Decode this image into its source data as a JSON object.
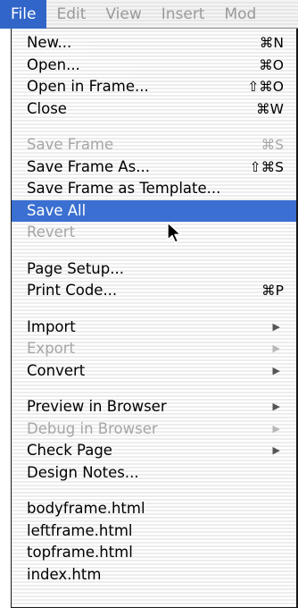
{
  "menubar": {
    "items": [
      {
        "label": "File",
        "active": true
      },
      {
        "label": "Edit"
      },
      {
        "label": "View"
      },
      {
        "label": "Insert"
      },
      {
        "label": "Mod"
      }
    ]
  },
  "file_menu": {
    "items": [
      {
        "label": "New...",
        "shortcut": "⌘N"
      },
      {
        "label": "Open...",
        "shortcut": "⌘O"
      },
      {
        "label": "Open in Frame...",
        "shortcut": "⇧⌘O"
      },
      {
        "label": "Close",
        "shortcut": "⌘W"
      },
      {
        "label": "Save Frame",
        "shortcut": "⌘S",
        "disabled": true
      },
      {
        "label": "Save Frame As...",
        "shortcut": "⇧⌘S"
      },
      {
        "label": "Save Frame as Template..."
      },
      {
        "label": "Save All",
        "highlighted": true
      },
      {
        "label": "Revert",
        "disabled": true
      },
      {
        "label": "Page Setup..."
      },
      {
        "label": "Print Code...",
        "shortcut": "⌘P"
      },
      {
        "label": "Import",
        "submenu": true
      },
      {
        "label": "Export",
        "submenu": true,
        "disabled": true
      },
      {
        "label": "Convert",
        "submenu": true
      },
      {
        "label": "Preview in Browser",
        "submenu": true
      },
      {
        "label": "Debug in Browser",
        "submenu": true,
        "disabled": true
      },
      {
        "label": "Check Page",
        "submenu": true
      },
      {
        "label": "Design Notes..."
      },
      {
        "label": "bodyframe.html"
      },
      {
        "label": "leftframe.html"
      },
      {
        "label": "topframe.html"
      },
      {
        "label": "index.htm"
      }
    ]
  },
  "icons": {
    "submenu_arrow": "▶"
  }
}
